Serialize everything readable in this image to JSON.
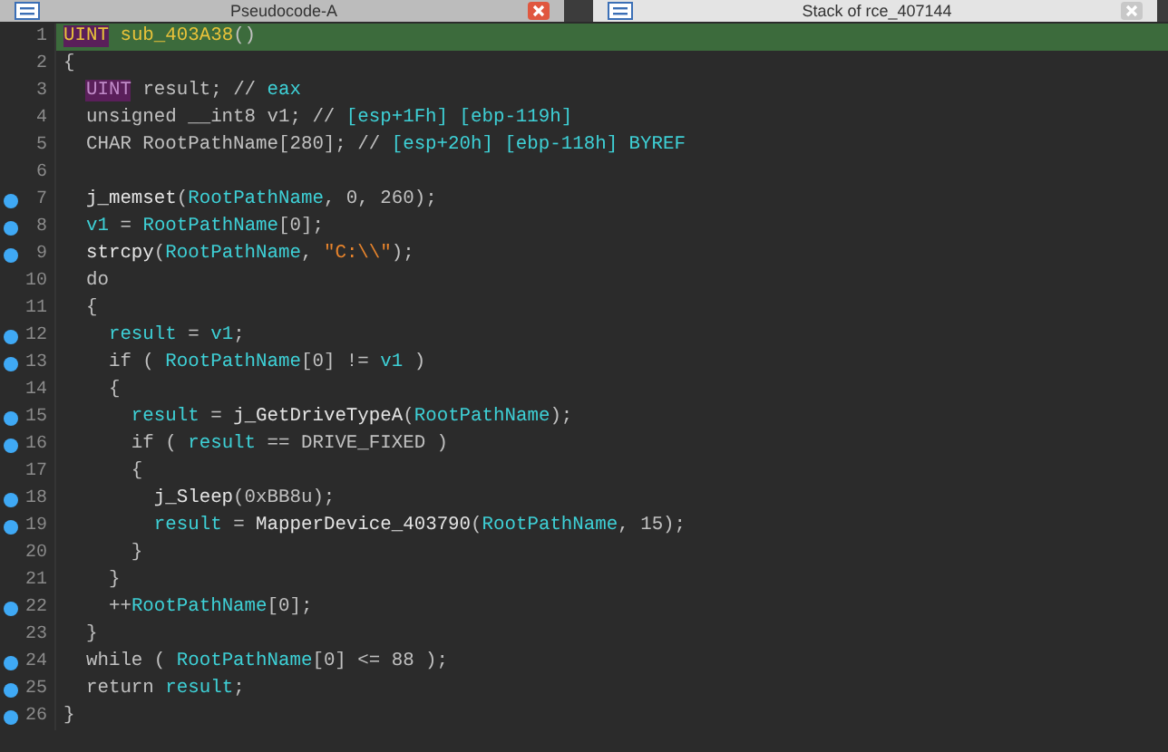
{
  "tabs": [
    {
      "label": "Pseudocode-A",
      "selected": true
    },
    {
      "label": "Stack of rce_407144",
      "selected": false
    }
  ],
  "lines": [
    {
      "number": "1",
      "marked": false,
      "current": true,
      "tokens": [
        {
          "kind": "type",
          "text": "UINT"
        },
        {
          "kind": "def",
          "text": " sub_403A38"
        },
        {
          "kind": "plain",
          "text": "()"
        }
      ]
    },
    {
      "number": "2",
      "marked": false,
      "current": false,
      "tokens": [
        {
          "kind": "plain",
          "text": "{"
        }
      ]
    },
    {
      "number": "3",
      "marked": false,
      "current": false,
      "tokens": [
        {
          "kind": "type",
          "text": "  UINT"
        },
        {
          "kind": "plain",
          "text": " result; // "
        },
        {
          "kind": "name",
          "text": "eax"
        }
      ]
    },
    {
      "number": "4",
      "marked": false,
      "current": false,
      "tokens": [
        {
          "kind": "plain",
          "text": "  unsigned __int8 v1; // "
        },
        {
          "kind": "name",
          "text": "[esp+1Fh] [ebp-119h]"
        }
      ]
    },
    {
      "number": "5",
      "marked": false,
      "current": false,
      "tokens": [
        {
          "kind": "plain",
          "text": "  CHAR RootPathName[280]; // "
        },
        {
          "kind": "name",
          "text": "[esp+20h] [ebp-118h] BYREF"
        }
      ]
    },
    {
      "number": "6",
      "marked": false,
      "current": false
    },
    {
      "number": "7",
      "marked": true,
      "current": false,
      "tokens": [
        {
          "kind": "func",
          "text": "  j_memset"
        },
        {
          "kind": "plain",
          "text": "("
        },
        {
          "kind": "name",
          "text": "RootPathName"
        },
        {
          "kind": "plain",
          "text": ", 0, 260);"
        }
      ]
    },
    {
      "number": "8",
      "marked": true,
      "current": false,
      "tokens": [
        {
          "kind": "name",
          "text": "  v1"
        },
        {
          "kind": "plain",
          "text": " = "
        },
        {
          "kind": "name",
          "text": "RootPathName"
        },
        {
          "kind": "plain",
          "text": "[0];"
        }
      ]
    },
    {
      "number": "9",
      "marked": true,
      "current": false,
      "tokens": [
        {
          "kind": "func",
          "text": "  strcpy"
        },
        {
          "kind": "plain",
          "text": "("
        },
        {
          "kind": "name",
          "text": "RootPathName"
        },
        {
          "kind": "plain",
          "text": ", "
        },
        {
          "kind": "string",
          "text": "\"C:\\\\\""
        },
        {
          "kind": "plain",
          "text": ");"
        }
      ]
    },
    {
      "number": "10",
      "marked": false,
      "current": false,
      "tokens": [
        {
          "kind": "plain",
          "text": "  do"
        }
      ]
    },
    {
      "number": "11",
      "marked": false,
      "current": false,
      "tokens": [
        {
          "kind": "plain",
          "text": "  {"
        }
      ]
    },
    {
      "number": "12",
      "marked": true,
      "current": false,
      "tokens": [
        {
          "kind": "name",
          "text": "    result"
        },
        {
          "kind": "plain",
          "text": " = "
        },
        {
          "kind": "name",
          "text": "v1"
        },
        {
          "kind": "plain",
          "text": ";"
        }
      ]
    },
    {
      "number": "13",
      "marked": true,
      "current": false,
      "tokens": [
        {
          "kind": "plain",
          "text": "    if ( "
        },
        {
          "kind": "name",
          "text": "RootPathName"
        },
        {
          "kind": "plain",
          "text": "[0] != "
        },
        {
          "kind": "name",
          "text": "v1"
        },
        {
          "kind": "plain",
          "text": " )"
        }
      ]
    },
    {
      "number": "14",
      "marked": false,
      "current": false,
      "tokens": [
        {
          "kind": "plain",
          "text": "    {"
        }
      ]
    },
    {
      "number": "15",
      "marked": true,
      "current": false,
      "tokens": [
        {
          "kind": "name",
          "text": "      result"
        },
        {
          "kind": "plain",
          "text": " = "
        },
        {
          "kind": "func",
          "text": "j_GetDriveTypeA"
        },
        {
          "kind": "plain",
          "text": "("
        },
        {
          "kind": "name",
          "text": "RootPathName"
        },
        {
          "kind": "plain",
          "text": ");"
        }
      ]
    },
    {
      "number": "16",
      "marked": true,
      "current": false,
      "tokens": [
        {
          "kind": "plain",
          "text": "      if ( "
        },
        {
          "kind": "name",
          "text": "result"
        },
        {
          "kind": "plain",
          "text": " == DRIVE_FIXED )"
        }
      ]
    },
    {
      "number": "17",
      "marked": false,
      "current": false,
      "tokens": [
        {
          "kind": "plain",
          "text": "      {"
        }
      ]
    },
    {
      "number": "18",
      "marked": true,
      "current": false,
      "tokens": [
        {
          "kind": "func",
          "text": "        j_Sleep"
        },
        {
          "kind": "plain",
          "text": "(0xBB8u);"
        }
      ]
    },
    {
      "number": "19",
      "marked": true,
      "current": false,
      "tokens": [
        {
          "kind": "name",
          "text": "        result"
        },
        {
          "kind": "plain",
          "text": " = "
        },
        {
          "kind": "func",
          "text": "MapperDevice_403790"
        },
        {
          "kind": "plain",
          "text": "("
        },
        {
          "kind": "name",
          "text": "RootPathName"
        },
        {
          "kind": "plain",
          "text": ", 15);"
        }
      ]
    },
    {
      "number": "20",
      "marked": false,
      "current": false,
      "tokens": [
        {
          "kind": "plain",
          "text": "      }"
        }
      ]
    },
    {
      "number": "21",
      "marked": false,
      "current": false,
      "tokens": [
        {
          "kind": "plain",
          "text": "    }"
        }
      ]
    },
    {
      "number": "22",
      "marked": true,
      "current": false,
      "tokens": [
        {
          "kind": "plain",
          "text": "    ++"
        },
        {
          "kind": "name",
          "text": "RootPathName"
        },
        {
          "kind": "plain",
          "text": "[0];"
        }
      ]
    },
    {
      "number": "23",
      "marked": false,
      "current": false,
      "tokens": [
        {
          "kind": "plain",
          "text": "  }"
        }
      ]
    },
    {
      "number": "24",
      "marked": true,
      "current": false,
      "tokens": [
        {
          "kind": "plain",
          "text": "  while ( "
        },
        {
          "kind": "name",
          "text": "RootPathName"
        },
        {
          "kind": "plain",
          "text": "[0] <= 88 );"
        }
      ]
    },
    {
      "number": "25",
      "marked": true,
      "current": false,
      "tokens": [
        {
          "kind": "plain",
          "text": "  return "
        },
        {
          "kind": "name",
          "text": "result"
        },
        {
          "kind": "plain",
          "text": ";"
        }
      ]
    },
    {
      "number": "26",
      "marked": true,
      "current": false,
      "tokens": [
        {
          "kind": "plain",
          "text": "}"
        }
      ]
    }
  ]
}
